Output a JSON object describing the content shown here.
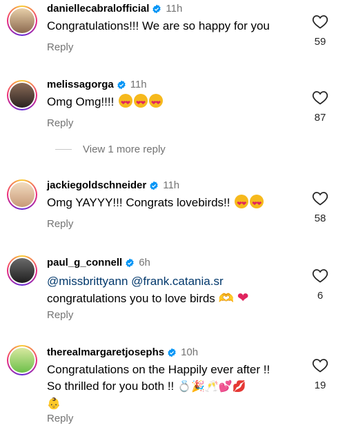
{
  "comments": [
    {
      "username": "daniellecabralofficial",
      "time": "11h",
      "text": "Congratulations!!! We are so happy for you",
      "reply_label": "Reply",
      "likes": "59"
    },
    {
      "username": "melissagorga",
      "time": "11h",
      "text": "Omg Omg!!!!",
      "reply_label": "Reply",
      "likes": "87"
    },
    {
      "username": "jackiegoldschneider",
      "time": "11h",
      "text": "Omg YAYYY!!! Congrats lovebirds!!",
      "reply_label": "Reply",
      "likes": "58"
    },
    {
      "username": "paul_g_connell",
      "time": "6h",
      "mention1": "@missbrittyann",
      "mention2": "@frank.catania.sr",
      "text": "congratulations you to love birds",
      "reply_label": "Reply",
      "likes": "6"
    },
    {
      "username": "therealmargaretjosephs",
      "time": "10h",
      "text_line1": "Congratulations on the Happily ever after !!",
      "text_line2": "So thrilled for you both !!",
      "reply_label": "Reply",
      "likes": "19"
    }
  ],
  "view_more_label": "View 1 more reply",
  "colors": {
    "mention": "#00376b",
    "secondary_text": "#737373",
    "verified": "#0095f6"
  }
}
